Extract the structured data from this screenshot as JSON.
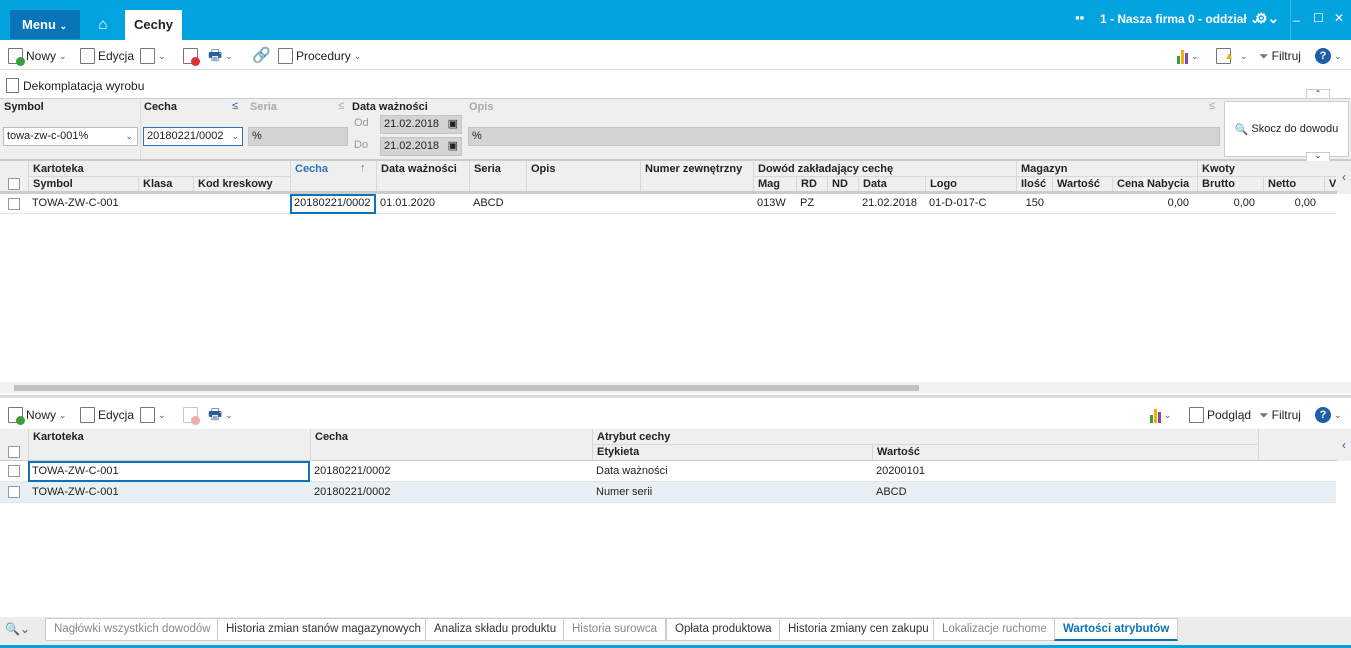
{
  "titlebar": {
    "menu": "Menu",
    "home_icon": "home-icon",
    "tab": "Cechy",
    "company": "1 - Nasza firma 0 - oddział",
    "accent": "#03a3e0"
  },
  "toolbar": {
    "new": "Nowy",
    "edit": "Edycja",
    "procedures": "Procedury",
    "filter": "Filtruj"
  },
  "action": {
    "dekomplatacja": "Dekomplatacja wyrobu"
  },
  "filters": {
    "symbol_label": "Symbol",
    "symbol_value": "towa-zw-c-001%",
    "cecha_label": "Cecha",
    "cecha_value": "20180221/0002",
    "seria_label": "Seria",
    "seria_value": "%",
    "data_label": "Data ważności",
    "od_label": "Od",
    "od_value": "21.02.2018",
    "do_label": "Do",
    "do_value": "21.02.2018",
    "opis_label": "Opis",
    "opis_value": "%",
    "jump_button": "Skocz do dowodu"
  },
  "grid": {
    "groups": [
      "Kartoteka",
      "Dowód zakładający cechę",
      "Magazyn",
      "Kwoty"
    ],
    "columns": [
      "Symbol",
      "Klasa",
      "Kod kreskowy",
      "Cecha",
      "Data ważności",
      "Seria",
      "Opis",
      "Numer zewnętrzny",
      "Mag",
      "RD",
      "ND",
      "Data",
      "Logo",
      "Ilość",
      "Wartość",
      "Cena Nabycia",
      "Brutto",
      "Netto",
      "V"
    ],
    "rows": [
      [
        "TOWA-ZW-C-001",
        "",
        "",
        "20180221/0002",
        "01.01.2020",
        "ABCD",
        "",
        "",
        "013W",
        "PZ",
        "",
        "21.02.2018",
        "01-D-017-C",
        "150",
        "",
        "0,00",
        "0,00",
        "0,00",
        ""
      ]
    ]
  },
  "bottom_toolbar": {
    "new": "Nowy",
    "edit": "Edycja",
    "preview": "Podgląd",
    "filter": "Filtruj"
  },
  "bottom_grid": {
    "columns": [
      "Kartoteka",
      "Cecha",
      "Atrybut cechy",
      "Etykieta",
      "Wartość"
    ],
    "rows": [
      [
        "TOWA-ZW-C-001",
        "20180221/0002",
        "Data ważności",
        "20200101"
      ],
      [
        "TOWA-ZW-C-001",
        "20180221/0002",
        "Numer serii",
        "ABCD"
      ]
    ]
  },
  "bottom_tabs": [
    {
      "label": "Nagłówki wszystkich dowodów",
      "state": "disabled"
    },
    {
      "label": "Historia zmian stanów magazynowych",
      "state": "normal"
    },
    {
      "label": "Analiza składu produktu",
      "state": "normal"
    },
    {
      "label": "Historia surowca",
      "state": "disabled"
    },
    {
      "label": "Opłata produktowa",
      "state": "normal"
    },
    {
      "label": "Historia zmiany cen zakupu",
      "state": "normal"
    },
    {
      "label": "Lokalizacje ruchome",
      "state": "disabled"
    },
    {
      "label": "Wartości atrybutów",
      "state": "active"
    }
  ]
}
